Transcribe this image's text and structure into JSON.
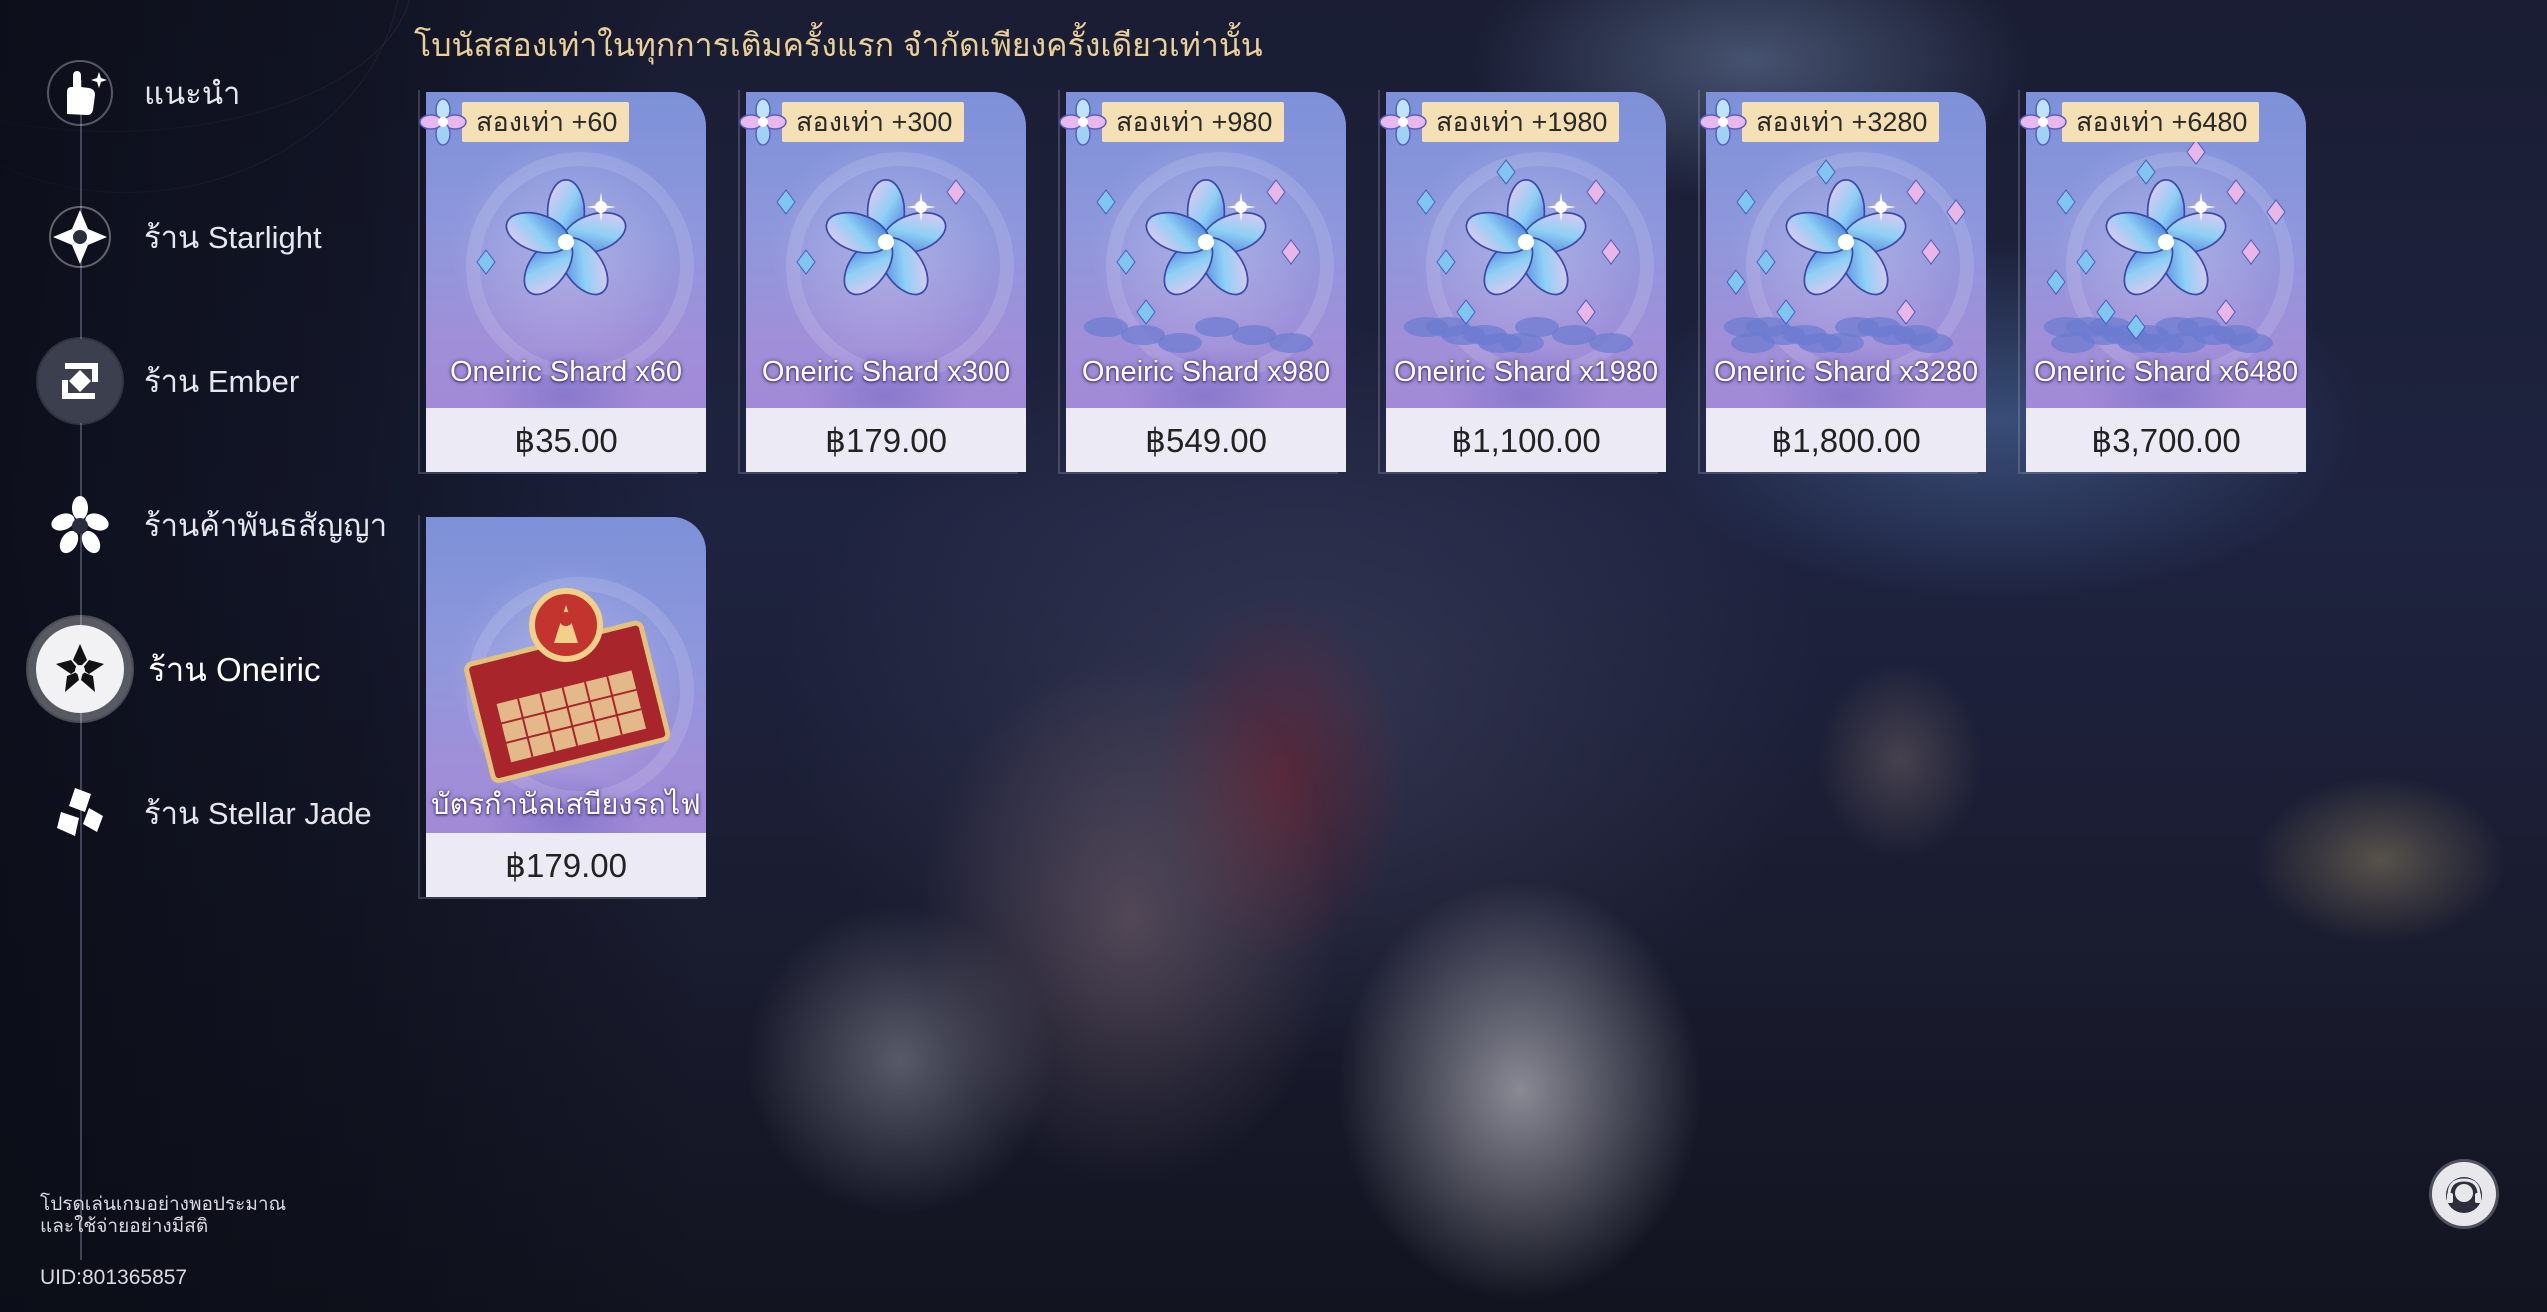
{
  "banner_text": "โบนัสสองเท่าในทุกการเติมครั้งแรก จำกัดเพียงครั้งเดียวเท่านั้น",
  "sidebar": {
    "items": [
      {
        "label": "แนะนำ",
        "icon": "star-hand-icon"
      },
      {
        "label": "ร้าน Starlight",
        "icon": "starlight-icon"
      },
      {
        "label": "ร้าน Ember",
        "icon": "ember-icon"
      },
      {
        "label": "ร้านค้าพันธสัญญา",
        "icon": "covenant-icon"
      },
      {
        "label": "ร้าน Oneiric",
        "icon": "oneiric-icon",
        "active": true
      },
      {
        "label": "ร้าน Stellar Jade",
        "icon": "stellar-jade-icon"
      }
    ],
    "notice_line1": "โปรดเล่นเกมอย่างพอประมาณ",
    "notice_line2": "และใช้จ่ายอย่างมีสติ",
    "uid": "UID:801365857"
  },
  "products": [
    {
      "name": "Oneiric Shard x60",
      "price": "฿35.00",
      "badge": "สองเท่า +60"
    },
    {
      "name": "Oneiric Shard x300",
      "price": "฿179.00",
      "badge": "สองเท่า +300"
    },
    {
      "name": "Oneiric Shard x980",
      "price": "฿549.00",
      "badge": "สองเท่า +980"
    },
    {
      "name": "Oneiric Shard x1980",
      "price": "฿1,100.00",
      "badge": "สองเท่า +1980"
    },
    {
      "name": "Oneiric Shard x3280",
      "price": "฿1,800.00",
      "badge": "สองเท่า +3280"
    },
    {
      "name": "Oneiric Shard x6480",
      "price": "฿3,700.00",
      "badge": "สองเท่า +6480"
    },
    {
      "name": "บัตรกำนัลเสบียงรถไฟ",
      "price": "฿179.00"
    }
  ],
  "colors": {
    "banner": "#e9cf98",
    "badge_bg": "#f5dfb4",
    "card_top": "#7d91d8",
    "card_bottom": "#a28ad6",
    "price_bg": "#ecebf5"
  },
  "support_icon": "customer-support-icon"
}
